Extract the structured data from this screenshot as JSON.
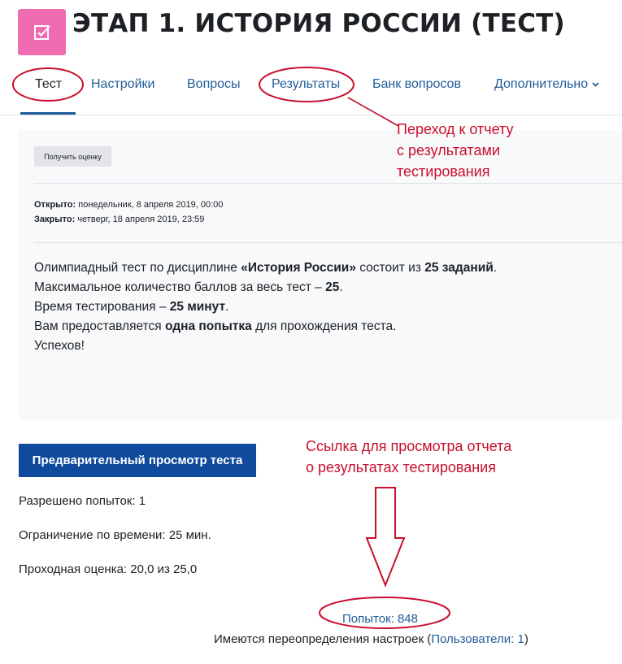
{
  "header": {
    "title": "ЭТАП 1. ИСТОРИЯ РОССИИ (ТЕСТ)",
    "icon": "quiz-icon",
    "icon_color": "#f06bb0"
  },
  "tabs": [
    {
      "label": "Тест",
      "active": true
    },
    {
      "label": "Настройки",
      "active": false
    },
    {
      "label": "Вопросы",
      "active": false
    },
    {
      "label": "Результаты",
      "active": false
    },
    {
      "label": "Банк вопросов",
      "active": false
    },
    {
      "label": "Дополнительно",
      "active": false
    }
  ],
  "info": {
    "grade_button": "Получить оценку",
    "opened_label": "Открыто:",
    "opened_value": "понедельник, 8 апреля 2019, 00:00",
    "closed_label": "Закрыто:",
    "closed_value": "четверг, 18 апреля 2019, 23:59",
    "description": {
      "line1_a": "Олимпиадный тест по дисциплине ",
      "line1_b": "«История России»",
      "line1_c": " состоит из ",
      "line1_d": "25 заданий",
      "line1_e": ".",
      "line2_a": "Максимальное количество баллов за весь тест – ",
      "line2_b": "25",
      "line2_c": ".",
      "line3_a": "Время тестирования – ",
      "line3_b": "25 минут",
      "line3_c": ".",
      "line4_a": "Вам предоставляется ",
      "line4_b": "одна попытка",
      "line4_c": " для прохождения теста.",
      "line5": "Успехов!"
    }
  },
  "actions": {
    "preview_button": "Предварительный просмотр теста"
  },
  "meta": {
    "attempts_allowed": "Разрешено попыток: 1",
    "time_limit": "Ограничение по времени: 25 мин.",
    "pass_grade": "Проходная оценка: 20,0 из 25,0",
    "attempts_link": "Попыток: 848",
    "overrides_prefix": "Имеются переопределения настроек (",
    "overrides_link": "Пользователи: 1",
    "overrides_suffix": ")"
  },
  "annotations": {
    "results_note": [
      "Переход к отчету",
      "с результатами",
      "тестирования"
    ],
    "attempts_note": [
      "Ссылка для просмотра отчета",
      "о результатах тестирования"
    ],
    "color": "#c8102e"
  },
  "colors": {
    "link": "#1f5c99",
    "primary_button": "#0f4a9c"
  }
}
